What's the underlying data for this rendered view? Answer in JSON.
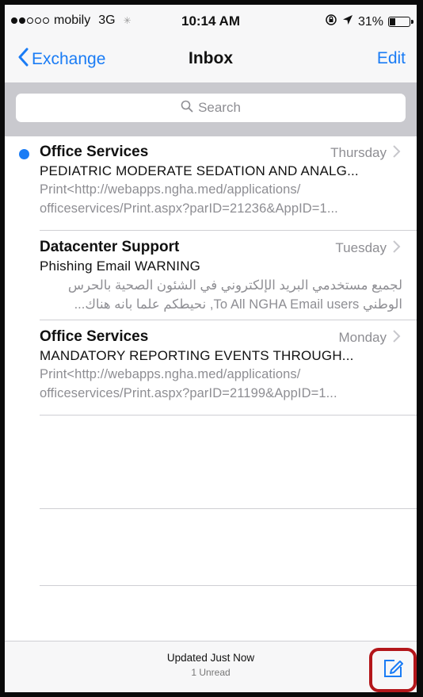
{
  "status_bar": {
    "carrier": "mobily",
    "network": "3G",
    "time": "10:14 AM",
    "battery": "31%",
    "battery_level": 0.31,
    "signal_bars_filled": 2,
    "signal_bars_total": 5
  },
  "nav": {
    "back_label": "Exchange",
    "title": "Inbox",
    "edit_label": "Edit"
  },
  "search": {
    "placeholder": "Search"
  },
  "messages": [
    {
      "sender": "Office Services",
      "date": "Thursday",
      "subject": "PEDIATRIC MODERATE SEDATION AND ANALG...",
      "preview_line1": "Print<http://webapps.ngha.med/applications/",
      "preview_line2": "officeservices/Print.aspx?parID=21236&AppID=1...",
      "unread": true
    },
    {
      "sender": "Datacenter Support",
      "date": "Tuesday",
      "subject": "Phishing Email WARNING",
      "preview_line1": "لجميع مستخدمي البريد الإلكتروني في الشئون الصحية بالحرس",
      "preview_line2": "الوطني To All NGHA Email users, نحيطكم علما بانه هناك...",
      "unread": false
    },
    {
      "sender": "Office Services",
      "date": "Monday",
      "subject": "MANDATORY REPORTING EVENTS THROUGH...",
      "preview_line1": "Print<http://webapps.ngha.med/applications/",
      "preview_line2": "officeservices/Print.aspx?parID=21199&AppID=1...",
      "unread": false
    }
  ],
  "footer": {
    "status": "Updated Just Now",
    "unread_count": "1 Unread"
  },
  "colors": {
    "accent": "#1a7cf5",
    "highlight_border": "#b3161a"
  }
}
